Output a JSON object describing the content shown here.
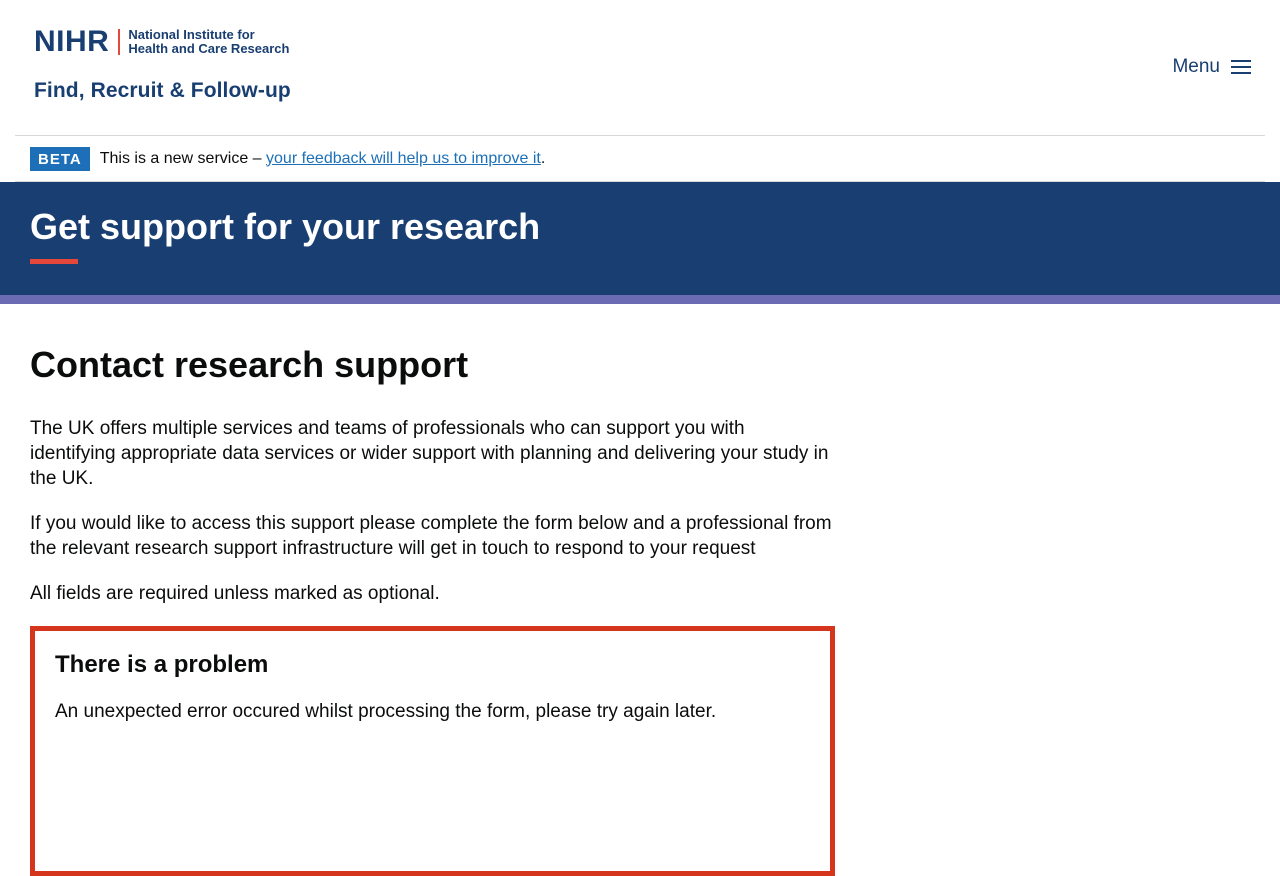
{
  "header": {
    "logo_mark": "NIHR",
    "logo_org_line1": "National Institute for",
    "logo_org_line2": "Health and Care Research",
    "service_name": "Find, Recruit & Follow-up",
    "menu_label": "Menu"
  },
  "beta_banner": {
    "tag": "BETA",
    "text_before": "This is a new service – ",
    "link_text": "your feedback will help us to improve it",
    "text_after": "."
  },
  "hero": {
    "title": "Get support for your research"
  },
  "main": {
    "heading": "Contact research support",
    "paragraphs": [
      "The UK offers multiple services and teams of professionals who can support you with identifying appropriate data services or wider support with planning and delivering your study in the UK.",
      "If you would like to access this support please complete the form below and a professional from the relevant research support infrastructure will get in touch to respond to your request",
      "All fields are required unless marked as optional."
    ]
  },
  "error_summary": {
    "title": "There is a problem",
    "message": "An unexpected error occured whilst processing the form, please try again later."
  },
  "colors": {
    "brand_navy": "#193e72",
    "accent_red": "#e5473a",
    "stripe_purple": "#6b6bb3",
    "link_blue": "#1d70b8",
    "error_red": "#d4351c"
  }
}
